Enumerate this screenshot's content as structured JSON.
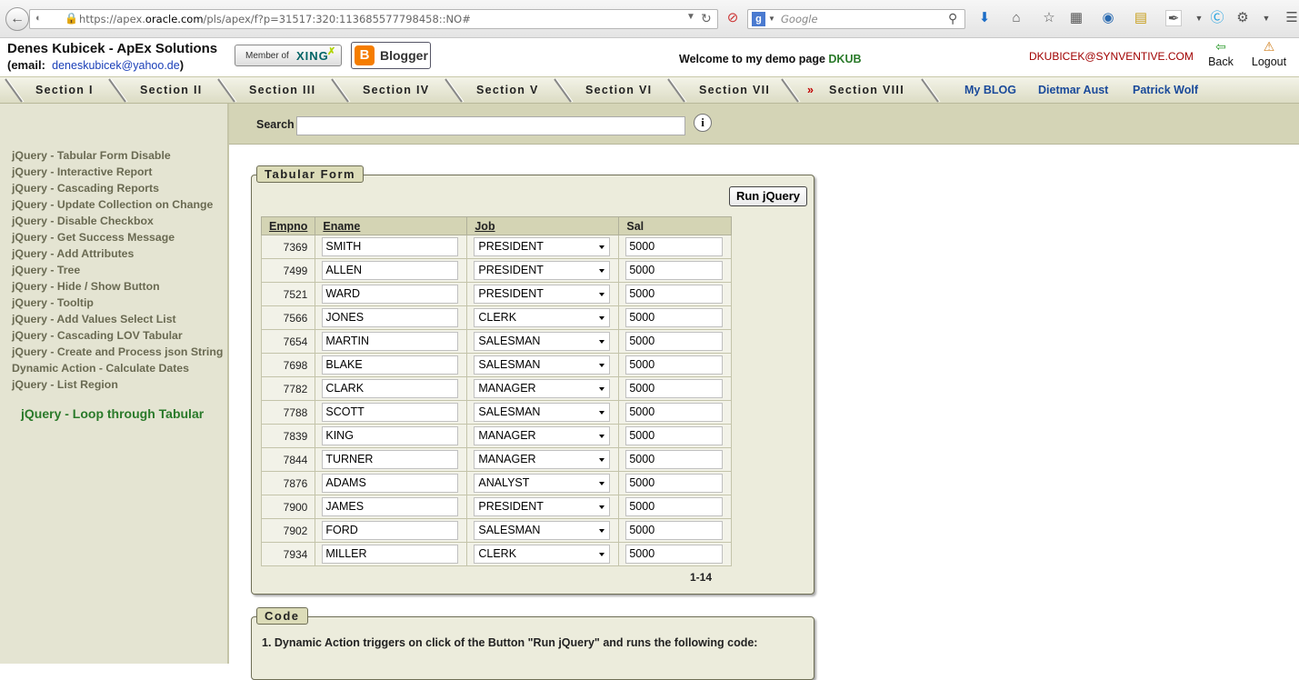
{
  "browser": {
    "url_prefix": "https://apex.",
    "url_domain": "oracle.com",
    "url_suffix": "/pls/apex/f?p=31517:320:113685577798458::NO#",
    "search_placeholder": "Google"
  },
  "header": {
    "title": "Denes Kubicek - ApEx Solutions",
    "email_label": "(email:",
    "email": "deneskubicek@yahoo.de",
    "email_close": ")",
    "xing_prefix": "Member of",
    "xing_brand": "XING",
    "blogger": "Blogger",
    "welcome": "Welcome to my demo page",
    "welcome_user": "DKUB",
    "account": "DKUBICEK@SYNVENTIVE.COM",
    "back": "Back",
    "logout": "Logout"
  },
  "nav": {
    "sections": [
      "Section I",
      "Section II",
      "Section III",
      "Section IV",
      "Section V",
      "Section VI",
      "Section VII",
      "Section VIII"
    ],
    "links": [
      "My BLOG",
      "Dietmar Aust",
      "Patrick Wolf"
    ],
    "active_marker": "»"
  },
  "sidebar": {
    "items": [
      "jQuery - Tabular Form Disable",
      "jQuery - Interactive Report",
      "jQuery - Cascading Reports",
      "jQuery - Update Collection on Change",
      "jQuery - Disable Checkbox",
      "jQuery - Get Success Message",
      "jQuery - Add Attributes",
      "jQuery - Tree",
      "jQuery - Hide / Show Button",
      "jQuery - Tooltip",
      "jQuery - Add Values Select List",
      "jQuery - Cascading LOV Tabular",
      "jQuery - Create and Process json String",
      "Dynamic Action - Calculate Dates",
      "jQuery - List Region"
    ],
    "current": "jQuery - Loop through Tabular"
  },
  "search": {
    "label": "Search",
    "value": ""
  },
  "tabular": {
    "title": "Tabular Form",
    "run_button": "Run jQuery",
    "columns": [
      "Empno",
      "Ename",
      "Job",
      "Sal"
    ],
    "rows": [
      {
        "empno": "7369",
        "ename": "SMITH",
        "job": "PRESIDENT",
        "sal": "5000"
      },
      {
        "empno": "7499",
        "ename": "ALLEN",
        "job": "PRESIDENT",
        "sal": "5000"
      },
      {
        "empno": "7521",
        "ename": "WARD",
        "job": "PRESIDENT",
        "sal": "5000"
      },
      {
        "empno": "7566",
        "ename": "JONES",
        "job": "CLERK",
        "sal": "5000"
      },
      {
        "empno": "7654",
        "ename": "MARTIN",
        "job": "SALESMAN",
        "sal": "5000"
      },
      {
        "empno": "7698",
        "ename": "BLAKE",
        "job": "SALESMAN",
        "sal": "5000"
      },
      {
        "empno": "7782",
        "ename": "CLARK",
        "job": "MANAGER",
        "sal": "5000"
      },
      {
        "empno": "7788",
        "ename": "SCOTT",
        "job": "SALESMAN",
        "sal": "5000"
      },
      {
        "empno": "7839",
        "ename": "KING",
        "job": "MANAGER",
        "sal": "5000"
      },
      {
        "empno": "7844",
        "ename": "TURNER",
        "job": "MANAGER",
        "sal": "5000"
      },
      {
        "empno": "7876",
        "ename": "ADAMS",
        "job": "ANALYST",
        "sal": "5000"
      },
      {
        "empno": "7900",
        "ename": "JAMES",
        "job": "PRESIDENT",
        "sal": "5000"
      },
      {
        "empno": "7902",
        "ename": "FORD",
        "job": "SALESMAN",
        "sal": "5000"
      },
      {
        "empno": "7934",
        "ename": "MILLER",
        "job": "CLERK",
        "sal": "5000"
      }
    ],
    "pagination": "1-14"
  },
  "code": {
    "title": "Code",
    "line1": "1. Dynamic Action triggers on click of the Button \"Run jQuery\" and runs the following code:"
  },
  "colors": {
    "accent_green": "#2a7a2a",
    "link_blue": "#1a4a9a",
    "account_red": "#a00000",
    "region_bg": "#ececdc"
  }
}
